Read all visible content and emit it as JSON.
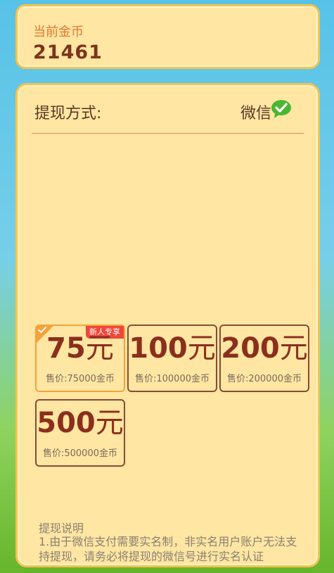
{
  "coins": {
    "label": "当前金币",
    "value": "21461"
  },
  "withdraw": {
    "method_label": "提现方式:",
    "method_value": "微信",
    "options": [
      {
        "amount": "75",
        "unit": "元",
        "price": "售价:75000金币",
        "badge": "新人专享",
        "selected": true
      },
      {
        "amount": "100",
        "unit": "元",
        "price": "售价:100000金币"
      },
      {
        "amount": "200",
        "unit": "元",
        "price": "售价:200000金币"
      },
      {
        "amount": "500",
        "unit": "元",
        "price": "售价:500000金币"
      }
    ]
  },
  "notes": {
    "title": "提现说明",
    "text": "1.由于微信支付需要实名制，非实名用户账户无法支持提现，请务必将提现的微信号进行实名认证"
  },
  "colors": {
    "accent": "#f4a23a",
    "brand_brown": "#8a2f1d",
    "badge": "#f0473a",
    "wechat": "#4cb633"
  },
  "icons": {
    "method": "wechat-icon",
    "selected": "check-icon"
  }
}
